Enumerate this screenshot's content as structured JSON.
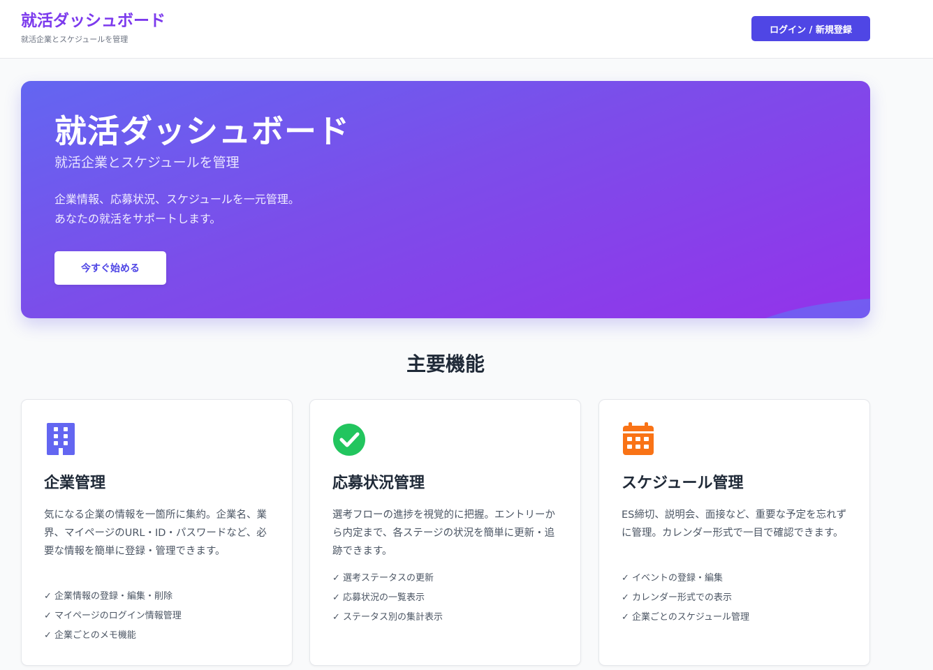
{
  "header": {
    "title": "就活ダッシュボード",
    "subtitle": "就活企業とスケジュールを管理",
    "login_label": "ログイン / 新規登録"
  },
  "hero": {
    "title": "就活ダッシュボード",
    "subtitle": "就活企業とスケジュールを管理",
    "description_line1": "企業情報、応募状況、スケジュールを一元管理。",
    "description_line2": "あなたの就活をサポートします。",
    "cta_label": "今すぐ始める"
  },
  "features": {
    "heading": "主要機能",
    "cards": [
      {
        "icon": "building-icon",
        "icon_color": "#6366f1",
        "title": "企業管理",
        "description": "気になる企業の情報を一箇所に集約。企業名、業界、マイページのURL・ID・パスワードなど、必要な情報を簡単に登録・管理できます。",
        "items": [
          "企業情報の登録・編集・削除",
          "マイページのログイン情報管理",
          "企業ごとのメモ機能"
        ]
      },
      {
        "icon": "check-circle-icon",
        "icon_color": "#22c55e",
        "title": "応募状況管理",
        "description": "選考フローの進捗を視覚的に把握。エントリーから内定まで、各ステージの状況を簡単に更新・追跡できます。",
        "items": [
          "選考ステータスの更新",
          "応募状況の一覧表示",
          "ステータス別の集計表示"
        ]
      },
      {
        "icon": "calendar-icon",
        "icon_color": "#f97316",
        "title": "スケジュール管理",
        "description": "ES締切、説明会、面接など、重要な予定を忘れずに管理。カレンダー形式で一目で確認できます。",
        "items": [
          "イベントの登録・編集",
          "カレンダー形式での表示",
          "企業ごとのスケジュール管理"
        ]
      }
    ]
  },
  "colors": {
    "accent": "#4f46e5",
    "brand_text": "#7c3aed",
    "hero_gradient_start": "#6366f1",
    "hero_gradient_end": "#9333ea"
  }
}
